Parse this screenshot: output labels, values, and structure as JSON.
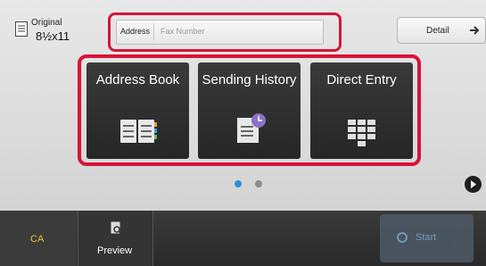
{
  "original": {
    "label": "Original",
    "value": "8½x11"
  },
  "address": {
    "label": "Address",
    "placeholder": "Fax Number"
  },
  "detail": {
    "label": "Detail"
  },
  "tiles": [
    {
      "label": "Address Book",
      "icon": "address-book-icon"
    },
    {
      "label": "Sending History",
      "icon": "history-clock-icon"
    },
    {
      "label": "Direct Entry",
      "icon": "keypad-icon"
    }
  ],
  "pager": {
    "pages": 2,
    "current": 1
  },
  "bottom": {
    "ca": "CA",
    "preview": "Preview",
    "start": "Start"
  },
  "colors": {
    "highlight": "#d8133a",
    "ca": "#e9c12b",
    "dot_active": "#2a8fd8",
    "dot_inactive": "#8a8a8a"
  }
}
